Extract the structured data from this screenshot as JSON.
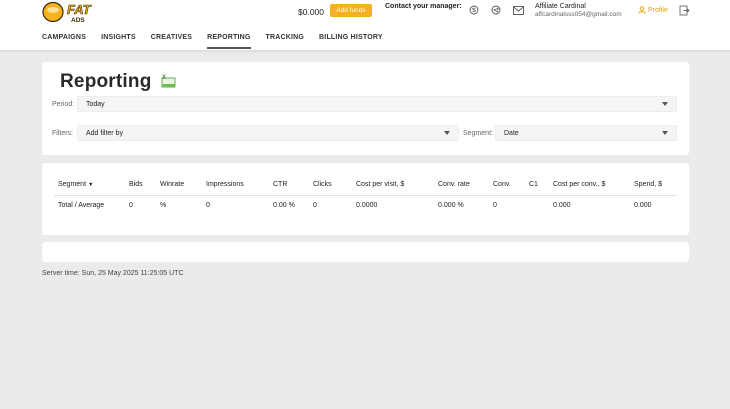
{
  "header": {
    "logo_text": "FAT ADS",
    "balance": "$0.000",
    "add_funds_label": "Add funds",
    "contact_label": "Contact your manager:",
    "manager_name": "Affiliate Cardinal",
    "manager_email": "affcardinalsss054@gmail.com",
    "profile_label": "Profile",
    "accent_color": "#f5b21f"
  },
  "nav": {
    "items": [
      {
        "label": "CAMPAIGNS"
      },
      {
        "label": "INSIGHTS"
      },
      {
        "label": "CREATIVES"
      },
      {
        "label": "REPORTING",
        "active": true
      },
      {
        "label": "TRACKING"
      },
      {
        "label": "BILLING HISTORY"
      }
    ]
  },
  "reporting": {
    "title": "Reporting",
    "period_label": "Period:",
    "period_value": "Today",
    "filters_label": "Filters:",
    "filters_value": "Add filter by",
    "segment_label": "Segment:",
    "segment_value": "Date"
  },
  "table": {
    "columns": [
      "Segment",
      "Bids",
      "Winrate",
      "Impressions",
      "CTR",
      "Clicks",
      "Cost per visit, $",
      "Conv. rate",
      "Conv.",
      "C1",
      "Cost per conv., $",
      "Spend, $"
    ],
    "sort_indicator": "▼",
    "total_row": [
      "Total / Average",
      "0",
      "%",
      "0",
      "0.00 %",
      "0",
      "0.0000",
      "0.000 %",
      "0",
      "",
      "0.000",
      "0.000"
    ]
  },
  "footer": {
    "server_time": "Server time: Sun, 25 May 2025 11:25:05 UTC"
  }
}
